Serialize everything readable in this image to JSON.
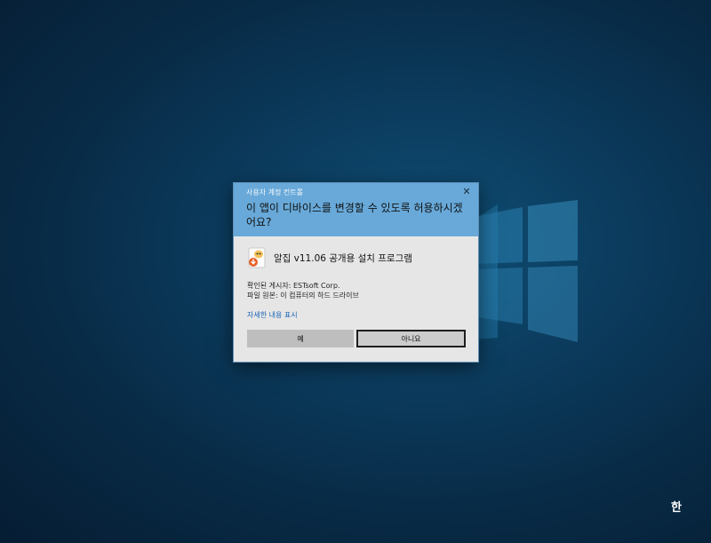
{
  "dialog": {
    "caption": "사용자 계정 컨트롤",
    "close_glyph": "✕",
    "question": "이 앱이 디바이스를 변경할 수 있도록 허용하시겠어요?",
    "app_name": "알집 v11.06 공개용 설치 프로그램",
    "publisher": "확인된 게시자: ESTsoft Corp.",
    "origin": "파일 원본: 이 컴퓨터의 하드 드라이브",
    "details_link": "자세한 내용 표시",
    "yes_label": "예",
    "no_label": "아니요",
    "header_color": "#68a9d9",
    "body_color": "#e6e6e6",
    "link_color": "#1a64b5"
  },
  "taskbar": {
    "ime_indicator": "한"
  },
  "icons": {
    "app": "alzip-installer-icon",
    "close": "close-icon",
    "background_logo": "windows-logo"
  }
}
